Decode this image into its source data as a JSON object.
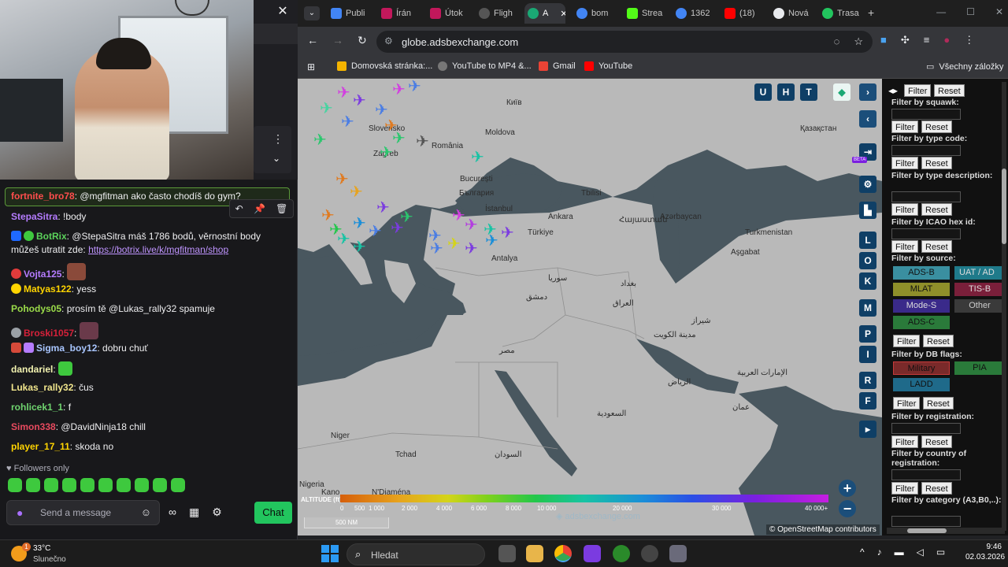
{
  "chat": {
    "close_label": "✕",
    "menu_dots": "⋮",
    "chevron": "⌄",
    "tools": [
      "↶",
      "📌",
      "🗑"
    ],
    "messages": [
      {
        "user": "fortnite_bro78",
        "color": "#ff4d4d",
        "text": "@mgfitman ako často chodíš do gym?"
      },
      {
        "user": "StepaSitra",
        "color": "#b57cff",
        "text": "!body"
      },
      {
        "user": "BotRix",
        "color": "#5bd35b",
        "text": "@StepaSitra máš 1786 bodů, věrnostní body můžeš utratit zde:",
        "link": "https://botrix.live/k/mgfitman/shop"
      },
      {
        "user": "Vojta125",
        "color": "#b57cff",
        "text": ""
      },
      {
        "user": "Matyas122",
        "color": "#ffd400",
        "text": "yess"
      },
      {
        "user": "Pohodys05",
        "color": "#9bdc4a",
        "text": "prosím tě @Lukas_rally32 spamuje"
      },
      {
        "user": "Broski1057",
        "color": "#d6213a",
        "text": ""
      },
      {
        "user": "Sigma_boy12",
        "color": "#a9c6ff",
        "text": "dobru chuť"
      },
      {
        "user": "dandariel",
        "color": "#f2f2b0",
        "text": ""
      },
      {
        "user": "Lukas_rally32",
        "color": "#f0e58c",
        "text": "čus"
      },
      {
        "user": "rohlicek1_1",
        "color": "#6fd46f",
        "text": "f"
      },
      {
        "user": "Simon338",
        "color": "#e84a5f",
        "text": "@DavidNinja18 chill"
      },
      {
        "user": "player_17_11",
        "color": "#ffd400",
        "text": "skoda no"
      }
    ],
    "followers_only": "Followers only",
    "input_placeholder": "Send a message",
    "chat_button": "Chat"
  },
  "browser": {
    "tabs": [
      {
        "label": "Publi",
        "color": "#4285f4"
      },
      {
        "label": "Írán",
        "color": "#c2185b"
      },
      {
        "label": "Útok",
        "color": "#c2185b"
      },
      {
        "label": "Fligh",
        "color": "#555555"
      },
      {
        "label": "A",
        "color": "#1aa874"
      },
      {
        "label": "bom",
        "color": "#4285f4"
      },
      {
        "label": "Strea",
        "color": "#53fc18"
      },
      {
        "label": "1362",
        "color": "#4285f4"
      },
      {
        "label": "(18)",
        "color": "#ff0000"
      },
      {
        "label": "Nová",
        "color": "#e8eaed"
      },
      {
        "label": "Trasa",
        "color": "#22c55e"
      }
    ],
    "url": "globe.adsbexchange.com",
    "bookmarks": [
      {
        "label": "Domovská stránka:...",
        "color": "#f4b400"
      },
      {
        "label": "YouTube to MP4 &...",
        "color": "#777777"
      },
      {
        "label": "Gmail",
        "color": "#ea4335"
      },
      {
        "label": "YouTube",
        "color": "#ff0000"
      }
    ],
    "all_bookmarks": "Všechny záložky"
  },
  "map": {
    "labels": [
      {
        "text": "Київ"
      },
      {
        "text": "Slovensko"
      },
      {
        "text": "România"
      },
      {
        "text": "Moldova"
      },
      {
        "text": "Zagreb"
      },
      {
        "text": "București"
      },
      {
        "text": "България"
      },
      {
        "text": "İstanbul"
      },
      {
        "text": "Türkiye"
      },
      {
        "text": "Ankara"
      },
      {
        "text": "Antalya"
      },
      {
        "text": "Қазақстан"
      },
      {
        "text": "Turkmenistan"
      },
      {
        "text": "Aşgabat"
      },
      {
        "text": "Azərbaycan"
      },
      {
        "text": "Հայաստան"
      },
      {
        "text": "سوريا"
      },
      {
        "text": "دمشق"
      },
      {
        "text": "بغداد"
      },
      {
        "text": "العراق"
      },
      {
        "text": "شیراز"
      },
      {
        "text": "مدينة الكويت"
      },
      {
        "text": "الرياض"
      },
      {
        "text": "مصر"
      },
      {
        "text": "السعودية"
      },
      {
        "text": "السودان"
      },
      {
        "text": "Niger"
      },
      {
        "text": "Tchad"
      },
      {
        "text": "Nigeria"
      },
      {
        "text": "Kano"
      },
      {
        "text": "N'Djaména"
      },
      {
        "text": "عمان"
      },
      {
        "text": "الإمارات العربية"
      },
      {
        "text": "Tbilisi"
      }
    ],
    "side_buttons": [
      "U",
      "H",
      "T",
      "L",
      "O",
      "K",
      "M",
      "P",
      "I",
      "R",
      "F"
    ],
    "beta": "BETA",
    "altitude_title": "ALTITUDE (ft)",
    "altitude_ticks": [
      "0",
      "500",
      "1 000",
      "2 000",
      "4 000",
      "6 000",
      "8 000",
      "10 000",
      "20 000",
      "30 000",
      "40 000+"
    ],
    "scale": "500 NM",
    "watermark": "adsbexchange.com",
    "attribution": "© OpenStreetMap contributors"
  },
  "filters": {
    "labels": {
      "squawk": "Filter by squawk:",
      "type_code": "Filter by type code:",
      "type_desc": "Filter by type description:",
      "icao": "Filter by ICAO hex id:",
      "source": "Filter by source:",
      "db_flags": "Filter by DB flags:",
      "registration": "Filter by registration:",
      "country": "Filter by country of registration:",
      "category": "Filter by category (A3,B0,..):"
    },
    "filter_btn": "Filter",
    "reset_btn": "Reset",
    "sources": [
      "ADS-B",
      "UAT / AD",
      "MLAT",
      "TIS-B",
      "Mode-S",
      "Other",
      "ADS-C"
    ],
    "db_flags": [
      "Military",
      "PIA",
      "LADD"
    ]
  },
  "taskbar": {
    "temp": "33°C",
    "weather": "Slunečno",
    "badge": "1",
    "search": "Hledat",
    "time": "9:46",
    "date": "02.03.2026"
  }
}
